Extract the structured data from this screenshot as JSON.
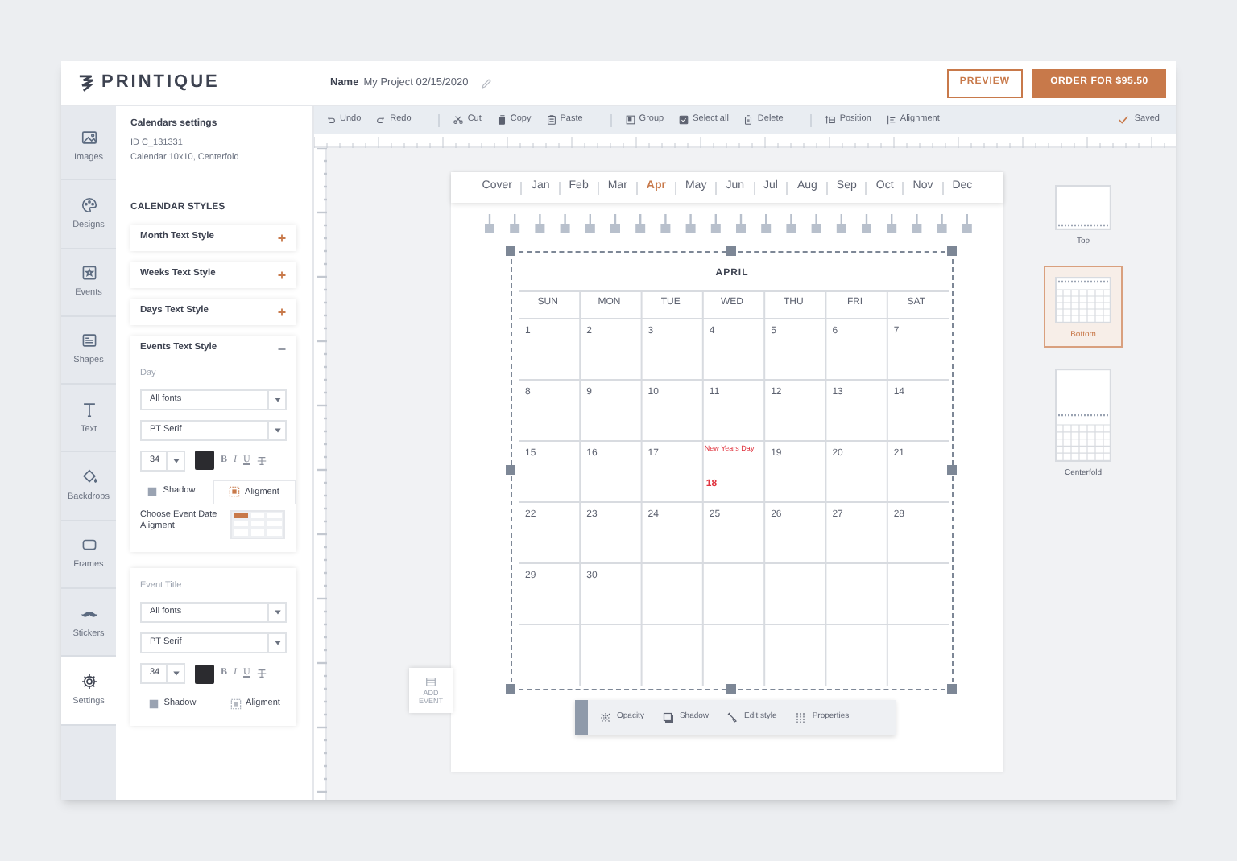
{
  "header": {
    "brand": "PRINTIQUE",
    "name_label": "Name",
    "project_name": "My Project 02/15/2020",
    "preview_button": "PREVIEW",
    "order_button": "ORDER FOR $95.50"
  },
  "nav": [
    {
      "kind": "images",
      "label": "Images",
      "selected": false
    },
    {
      "kind": "designs",
      "label": "Designs",
      "selected": false
    },
    {
      "kind": "events",
      "label": "Events",
      "selected": false
    },
    {
      "kind": "shapes",
      "label": "Shapes",
      "selected": false
    },
    {
      "kind": "text",
      "label": "Text",
      "selected": false
    },
    {
      "kind": "backdrops",
      "label": "Backdrops",
      "selected": false
    },
    {
      "kind": "frames",
      "label": "Frames",
      "selected": false
    },
    {
      "kind": "stickers",
      "label": "Stickers",
      "selected": false
    },
    {
      "kind": "settings",
      "label": "Settings",
      "selected": true
    }
  ],
  "settings": {
    "title": "Calendars settings",
    "id": "ID C_131331",
    "description": "Calendar 10x10, Centerfold",
    "styles_heading": "CALENDAR STYLES",
    "sections": [
      {
        "title": "Month Text Style",
        "expanded": false
      },
      {
        "title": "Weeks Text Style",
        "expanded": false
      },
      {
        "title": "Days Text Style",
        "expanded": false
      },
      {
        "title": "Events Text Style",
        "expanded": true,
        "editor": {
          "label": "Day",
          "font_family": "All fonts",
          "font": "PT Serif",
          "size": "34",
          "format": [
            "B",
            "I",
            "U"
          ],
          "tabs": [
            {
              "kind": "shadow",
              "label": "Shadow",
              "selected": false
            },
            {
              "kind": "alignment",
              "label": "Aligment",
              "selected": true
            }
          ],
          "choose_label": "Choose Event Date Aligment",
          "alignment_cells": [
            {
              "selected": true
            },
            {
              "selected": false
            },
            {
              "selected": false
            },
            {
              "selected": false
            },
            {
              "selected": false
            },
            {
              "selected": false
            },
            {
              "selected": false
            },
            {
              "selected": false
            },
            {
              "selected": false
            }
          ]
        }
      }
    ],
    "event_title_editor": {
      "label": "Event Title",
      "font_family": "All fonts",
      "font": "PT Serif",
      "size": "34",
      "format": [
        "B",
        "I",
        "U"
      ],
      "tabs": [
        {
          "kind": "shadow",
          "label": "Shadow",
          "selected": false
        },
        {
          "kind": "alignment",
          "label": "Aligment",
          "selected": false
        }
      ]
    }
  },
  "toolbar": {
    "groups": [
      [
        {
          "kind": "undo",
          "label": "Undo"
        },
        {
          "kind": "redo",
          "label": "Redo"
        }
      ],
      [
        {
          "kind": "cut",
          "label": "Cut"
        },
        {
          "kind": "copy",
          "label": "Copy"
        },
        {
          "kind": "paste",
          "label": "Paste"
        }
      ],
      [
        {
          "kind": "group",
          "label": "Group"
        },
        {
          "kind": "select",
          "label": "Select all"
        },
        {
          "kind": "delete",
          "label": "Delete"
        }
      ],
      [
        {
          "kind": "position",
          "label": "Position"
        },
        {
          "kind": "alignment",
          "label": "Alignment"
        }
      ]
    ],
    "status": "Saved"
  },
  "months": [
    {
      "label": "Cover",
      "selected": false
    },
    {
      "label": "Jan",
      "selected": false
    },
    {
      "label": "Feb",
      "selected": false
    },
    {
      "label": "Mar",
      "selected": false
    },
    {
      "label": "Apr",
      "selected": true
    },
    {
      "label": "May",
      "selected": false
    },
    {
      "label": "Jun",
      "selected": false
    },
    {
      "label": "Jul",
      "selected": false
    },
    {
      "label": "Aug",
      "selected": false
    },
    {
      "label": "Sep",
      "selected": false
    },
    {
      "label": "Oct",
      "selected": false
    },
    {
      "label": "Nov",
      "selected": false
    },
    {
      "label": "Dec",
      "selected": false
    }
  ],
  "calendar": {
    "title": "APRIL",
    "weekdays": [
      "SUN",
      "MON",
      "TUE",
      "WED",
      "THU",
      "FRI",
      "SAT"
    ],
    "weeks": [
      [
        {
          "day": "1"
        },
        {
          "day": "2"
        },
        {
          "day": "3"
        },
        {
          "day": "4"
        },
        {
          "day": "5"
        },
        {
          "day": "6"
        },
        {
          "day": "7"
        }
      ],
      [
        {
          "day": "8"
        },
        {
          "day": "9"
        },
        {
          "day": "10"
        },
        {
          "day": "11"
        },
        {
          "day": "12"
        },
        {
          "day": "13"
        },
        {
          "day": "14"
        }
      ],
      [
        {
          "day": "15"
        },
        {
          "day": "16"
        },
        {
          "day": "17"
        },
        {
          "day": "18",
          "event": "New Years Day",
          "holiday": true
        },
        {
          "day": "19"
        },
        {
          "day": "20"
        },
        {
          "day": "21"
        }
      ],
      [
        {
          "day": "22"
        },
        {
          "day": "23"
        },
        {
          "day": "24"
        },
        {
          "day": "25"
        },
        {
          "day": "26"
        },
        {
          "day": "27"
        },
        {
          "day": "28"
        }
      ],
      [
        {
          "day": "29"
        },
        {
          "day": "30"
        }
      ]
    ]
  },
  "add_event": "ADD EVENT",
  "selection_toolbar": [
    {
      "kind": "opacity",
      "label": "Opacity"
    },
    {
      "kind": "shadow",
      "label": "Shadow"
    },
    {
      "kind": "edit",
      "label": "Edit style"
    },
    {
      "kind": "properties",
      "label": "Properties"
    }
  ],
  "layouts": [
    {
      "kind": "top",
      "label": "Top",
      "selected": false
    },
    {
      "kind": "bottom",
      "label": "Bottom",
      "selected": true
    },
    {
      "kind": "centerfold",
      "label": "Centerfold",
      "selected": false
    }
  ]
}
